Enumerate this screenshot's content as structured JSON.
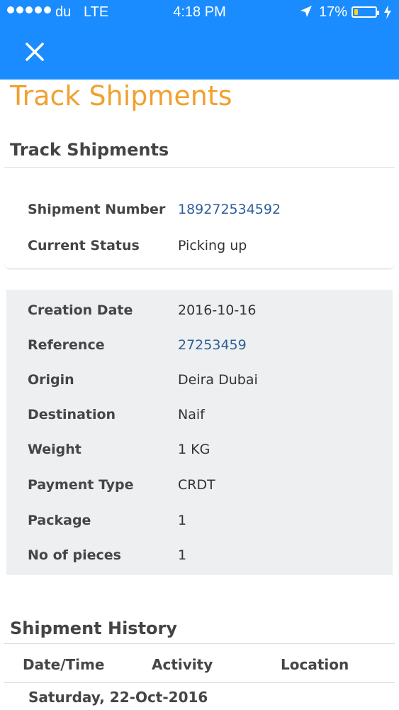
{
  "status_bar": {
    "carrier": "du",
    "network": "LTE",
    "time": "4:18 PM",
    "battery_pct": "17%",
    "battery_level": 0.17,
    "signal_dots": 5
  },
  "header": {
    "close_icon": "close-icon",
    "bar_color": "#1a8cff"
  },
  "page_title": "Track Shipments",
  "summary": {
    "heading": "Track Shipments",
    "rows": [
      {
        "label": "Shipment Number",
        "value": "189272534592"
      },
      {
        "label": "Current Status",
        "value": "Picking up"
      }
    ]
  },
  "details": {
    "rows": [
      {
        "label": "Creation Date",
        "value": "2016-10-16"
      },
      {
        "label": "Reference",
        "value": "27253459"
      },
      {
        "label": "Origin",
        "value": "Deira Dubai"
      },
      {
        "label": "Destination",
        "value": "Naif"
      },
      {
        "label": "Weight",
        "value": "1 KG"
      },
      {
        "label": "Payment Type",
        "value": "CRDT"
      },
      {
        "label": "Package",
        "value": "1"
      },
      {
        "label": "No of pieces",
        "value": "1"
      }
    ]
  },
  "history": {
    "heading": "Shipment History",
    "columns": [
      "Date/Time",
      "Activity",
      "Location"
    ],
    "date_group": "Saturday, 22-Oct-2016"
  },
  "colors": {
    "accent_orange": "#f0a12f",
    "link_blue": "#2d5f9a"
  }
}
